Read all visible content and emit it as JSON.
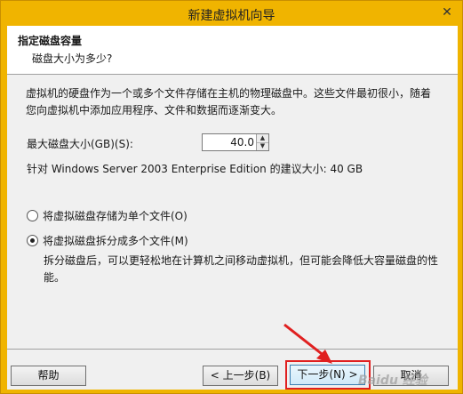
{
  "window": {
    "title": "新建虚拟机向导",
    "close_glyph": "✕"
  },
  "header": {
    "title": "指定磁盘容量",
    "subtitle": "磁盘大小为多少?"
  },
  "body": {
    "description": "虚拟机的硬盘作为一个或多个文件存储在主机的物理磁盘中。这些文件最初很小，随着您向虚拟机中添加应用程序、文件和数据而逐渐变大。",
    "max_disk_label": "最大磁盘大小(GB)(S):",
    "max_disk_value": "40.0",
    "recommendation": "针对 Windows Server 2003 Enterprise Edition 的建议大小: 40 GB",
    "radio_single_label": "将虚拟磁盘存储为单个文件(O)",
    "radio_single_checked": false,
    "radio_split_label": "将虚拟磁盘拆分成多个文件(M)",
    "radio_split_checked": true,
    "split_description": "拆分磁盘后，可以更轻松地在计算机之间移动虚拟机，但可能会降低大容量磁盘的性能。"
  },
  "footer": {
    "help_label": "帮助",
    "back_label": "< 上一步(B)",
    "next_label": "下一步(N) >",
    "cancel_label": "取消"
  },
  "watermark": {
    "text": "Baidu 经验"
  },
  "colors": {
    "accent_border": "#e02020",
    "title_bar": "#f0b400"
  }
}
